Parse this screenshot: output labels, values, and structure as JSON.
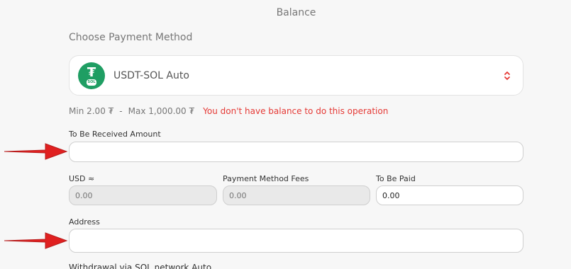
{
  "header": {
    "title": "Balance"
  },
  "payment_method": {
    "section_title": "Choose Payment Method",
    "selected": "USDT-SOL Auto",
    "icon": "usdt-sol-icon",
    "icon_badge": "SOL",
    "icon_glyph": "₮"
  },
  "limits": {
    "min": "Min 2.00 ₮",
    "separator": "-",
    "max": "Max 1,000.00 ₮",
    "error": "You don't have balance to do this operation",
    "error_color": "#e53935"
  },
  "fields": {
    "received_label": "To Be Received Amount",
    "received_value": "",
    "usd_label": "USD ≈",
    "usd_placeholder": "0.00",
    "fees_label": "Payment Method Fees",
    "fees_placeholder": "0.00",
    "paid_label": "To Be Paid",
    "paid_value": "0.00",
    "address_label": "Address",
    "address_value": ""
  },
  "footer": {
    "partial_text": "Withdrawal via SOL network Auto"
  },
  "annotations": {
    "arrow_color": "#e02020"
  }
}
